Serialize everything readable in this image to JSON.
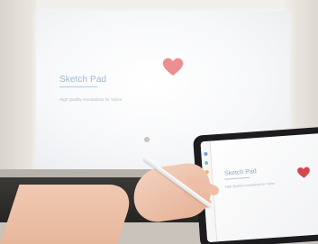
{
  "projection": {
    "app_title": "Sketch Pad",
    "subtitle": "High Quality Annotations for Vision",
    "heart_color": "#e77b7e"
  },
  "ipad": {
    "app_title": "Sketch Pad",
    "subtitle": "High Quality Annotations for Vision",
    "heart_color": "#d8454c",
    "toolbar_colors": [
      "#6f9ee0",
      "#7fc6a3",
      "#f2b64a",
      "#e2666d",
      "#9b7bd6"
    ]
  }
}
